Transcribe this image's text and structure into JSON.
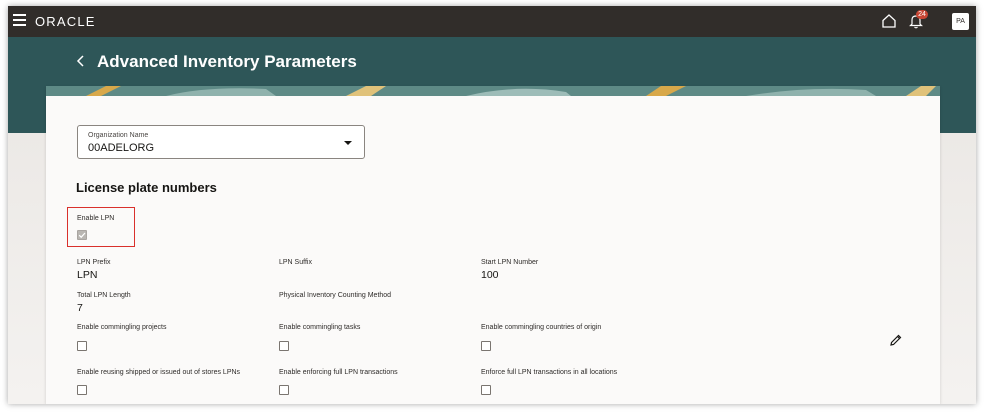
{
  "app": {
    "logo_text": "ORACLE",
    "notification_count": "24",
    "user_initials": "PA"
  },
  "page": {
    "title": "Advanced Inventory Parameters"
  },
  "organization": {
    "label": "Organization Name",
    "value": "00ADELORG"
  },
  "section": {
    "title": "License plate numbers"
  },
  "fields": {
    "enable_lpn": {
      "label": "Enable LPN",
      "checked": true
    },
    "lpn_prefix": {
      "label": "LPN Prefix",
      "value": "LPN"
    },
    "lpn_suffix": {
      "label": "LPN Suffix",
      "value": ""
    },
    "start_lpn_number": {
      "label": "Start LPN Number",
      "value": "100"
    },
    "total_lpn_length": {
      "label": "Total LPN Length",
      "value": "7"
    },
    "physical_inventory_counting_method": {
      "label": "Physical Inventory Counting Method",
      "value": ""
    },
    "enable_commingling_projects": {
      "label": "Enable commingling projects",
      "checked": false
    },
    "enable_commingling_tasks": {
      "label": "Enable commingling tasks",
      "checked": false
    },
    "enable_commingling_countries": {
      "label": "Enable commingling countries of origin",
      "checked": false
    },
    "enable_reusing_lpns": {
      "label": "Enable reusing shipped or issued out of stores LPNs",
      "checked": false
    },
    "enable_enforcing_full_lpn": {
      "label": "Enable enforcing full LPN transactions",
      "checked": false
    },
    "enforce_full_lpn_all_locations": {
      "label": "Enforce full LPN transactions in all locations",
      "checked": false
    }
  },
  "colors": {
    "topbar": "#312d2a",
    "header_band": "#2e5658",
    "badge": "#c74634",
    "highlight": "#d9302c"
  }
}
